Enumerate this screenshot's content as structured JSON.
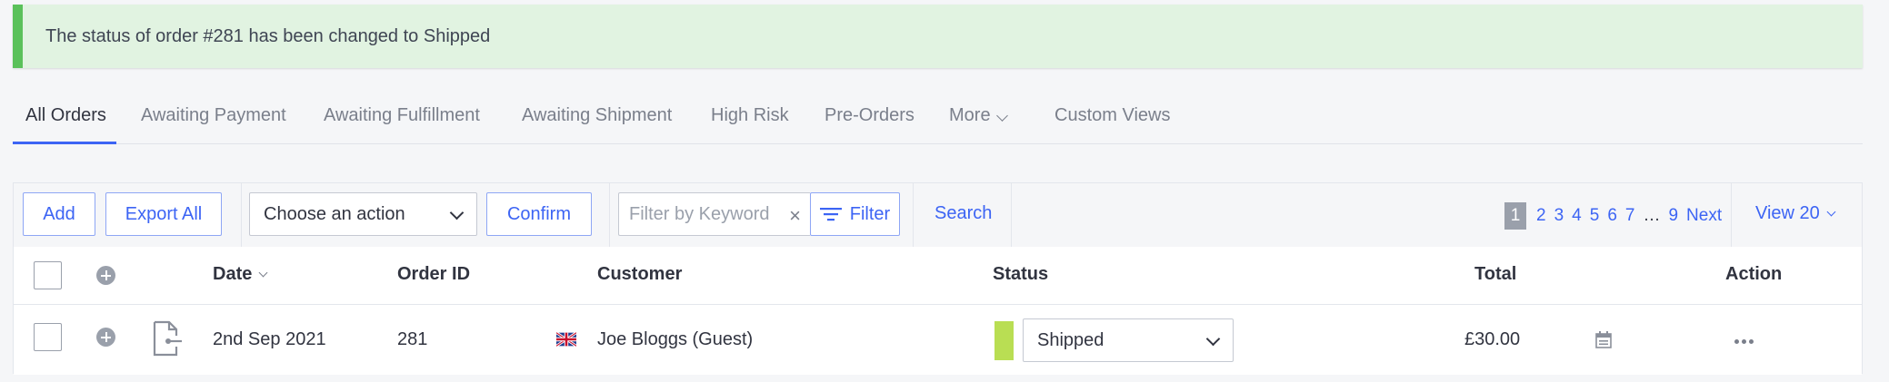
{
  "alert": {
    "message": "The status of order #281 has been changed to Shipped"
  },
  "tabs": [
    {
      "label": "All Orders"
    },
    {
      "label": "Awaiting Payment"
    },
    {
      "label": "Awaiting Fulfillment"
    },
    {
      "label": "Awaiting Shipment"
    },
    {
      "label": "High Risk"
    },
    {
      "label": "Pre-Orders"
    },
    {
      "label": "More"
    },
    {
      "label": "Custom Views"
    }
  ],
  "toolbar": {
    "add_label": "Add",
    "export_label": "Export All",
    "action_select": "Choose an action",
    "confirm_label": "Confirm",
    "filter_placeholder": "Filter by Keyword",
    "filter_label": "Filter",
    "search_label": "Search",
    "pagination": {
      "current": "1",
      "pages": [
        "2",
        "3",
        "4",
        "5",
        "6",
        "7"
      ],
      "ellipsis": "…",
      "last": "9",
      "next": "Next"
    },
    "view_label": "View 20"
  },
  "table": {
    "columns": {
      "date": "Date",
      "order_id": "Order ID",
      "customer": "Customer",
      "status": "Status",
      "total": "Total",
      "action": "Action"
    },
    "rows": [
      {
        "date": "2nd Sep 2021",
        "order_id": "281",
        "country_flag": "uk-flag-icon",
        "customer": "Joe Bloggs (Guest)",
        "status": "Shipped",
        "status_color": "#b9de53",
        "total": "£30.00"
      }
    ]
  },
  "colors": {
    "accent": "#3c64f4",
    "success": "#5ac15a"
  }
}
